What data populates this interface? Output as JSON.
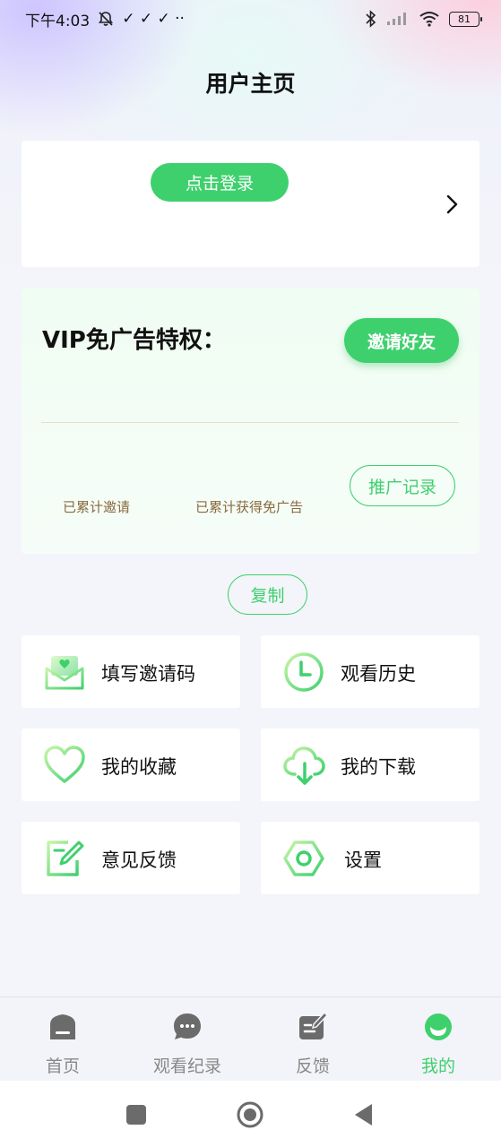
{
  "status_bar": {
    "time": "下午4:03",
    "extra_icons": "✓ ✓ ✓ ··",
    "battery": "81"
  },
  "header": {
    "title": "用户主页"
  },
  "login_card": {
    "login_label": "点击登录"
  },
  "vip": {
    "title": "VIP免广告特权：",
    "invite_label": "邀请好友",
    "invited_label": "已累计邀请",
    "earned_label": "已累计获得免广告",
    "promo_label": "推广记录"
  },
  "copy_label": "复制",
  "menu": {
    "items": [
      {
        "label": "填写邀请码",
        "icon": "envelope-heart-icon"
      },
      {
        "label": "观看历史",
        "icon": "clock-icon"
      },
      {
        "label": "我的收藏",
        "icon": "heart-icon"
      },
      {
        "label": "我的下载",
        "icon": "cloud-download-icon"
      },
      {
        "label": "意见反馈",
        "icon": "edit-note-icon"
      },
      {
        "label": "设置",
        "icon": "hexagon-settings-icon"
      }
    ]
  },
  "bottom_nav": {
    "items": [
      {
        "label": "首页",
        "icon": "home-icon"
      },
      {
        "label": "观看纪录",
        "icon": "chat-bubble-icon"
      },
      {
        "label": "反馈",
        "icon": "feedback-icon"
      },
      {
        "label": "我的",
        "icon": "profile-icon"
      }
    ],
    "active_color": "#3fd06e",
    "inactive_color": "#888888"
  },
  "colors": {
    "accent": "#3fd06e",
    "stat_text": "#8a6a3d"
  }
}
